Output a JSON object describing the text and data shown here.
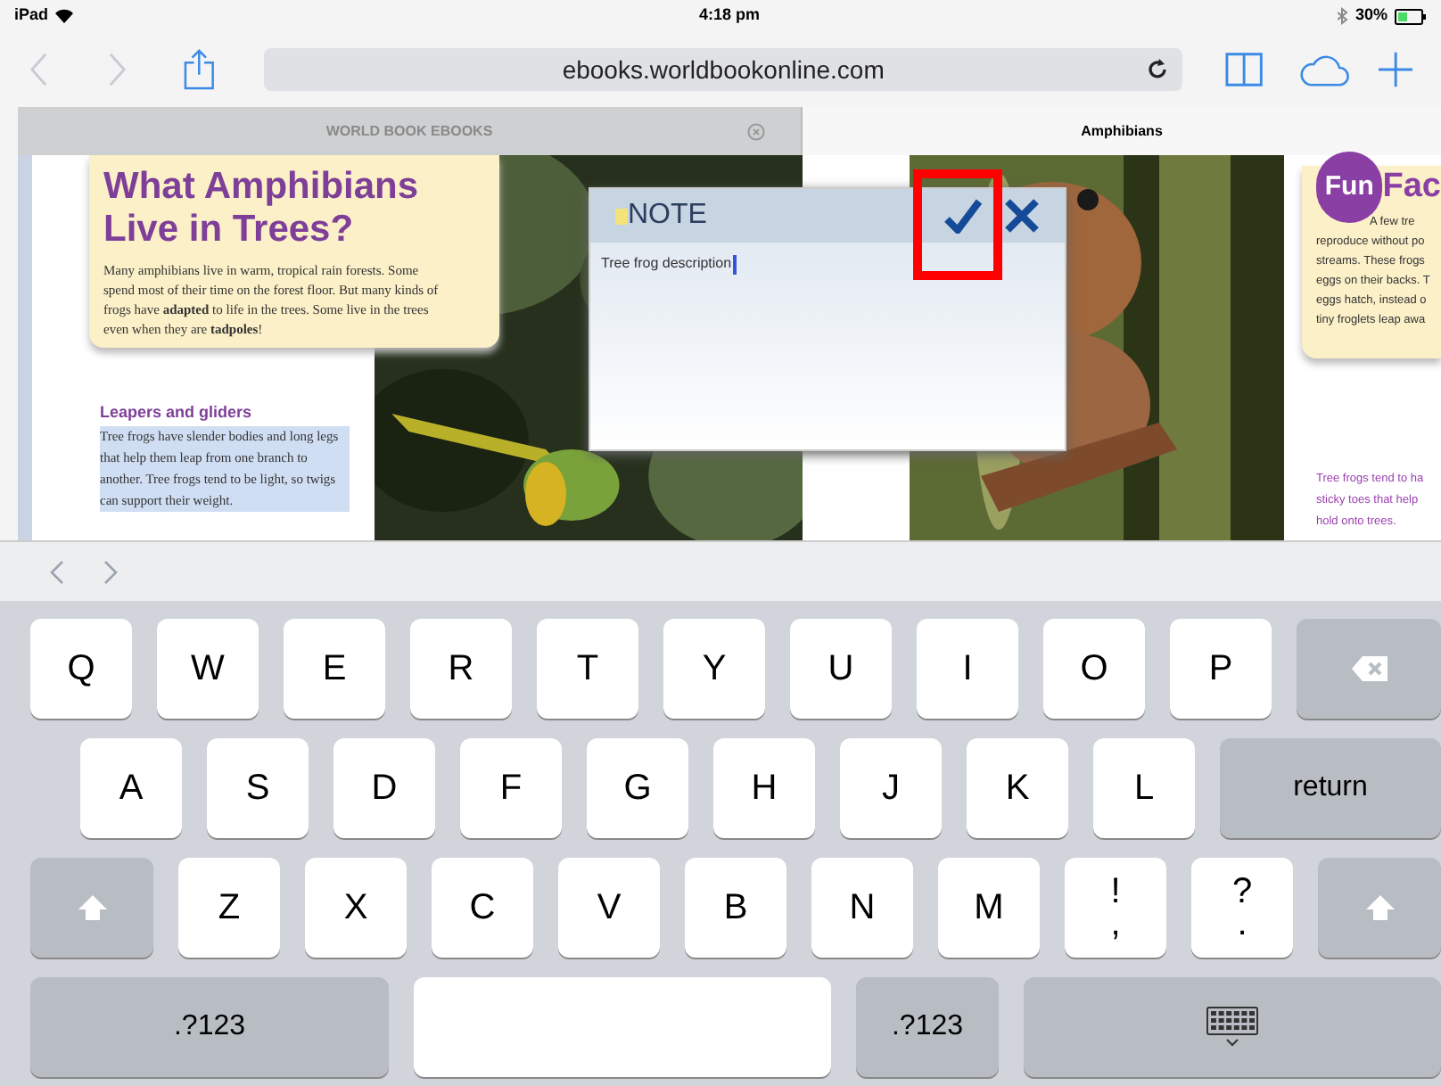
{
  "status_bar": {
    "device": "iPad",
    "time": "4:18 pm",
    "battery": "30%"
  },
  "toolbar": {
    "back_disabled": true,
    "forward_disabled": true,
    "address": "ebooks.worldbookonline.com"
  },
  "tabs": [
    {
      "label": "WORLD BOOK EBOOKS",
      "selected": false,
      "closable": true
    },
    {
      "label": "Amphibians",
      "selected": true,
      "closable": false
    }
  ],
  "page": {
    "title_lines": [
      "What Amphibians",
      "Live in Trees?"
    ],
    "intro": "Many amphibians live in warm, tropical rain forests. Some spend most of their time on the forest floor. But many kinds of frogs have **adapted** to life in the trees. Some live in the trees even when they are **tadpoles**!",
    "subheading": "Leapers and gliders",
    "selected_text": "Tree frogs have slender bodies and long legs that help them leap from one branch to another. Tree frogs tend to be light, so twigs can support their weight.",
    "fun_badge": "Fun",
    "fun_title": "Fac",
    "fun_lines": [
      "A few tre",
      "reproduce without po",
      "streams. These frogs",
      "eggs on their backs. T",
      "eggs hatch, instead o",
      "tiny froglets leap awa"
    ],
    "caption_lines": [
      "Tree frogs tend to ha",
      "sticky toes that help",
      "hold onto trees."
    ]
  },
  "note": {
    "title": "NOTE",
    "text": "Tree frog description"
  },
  "keyboard": {
    "rows": [
      {
        "keys": [
          {
            "kind": "key",
            "label": "Q"
          },
          {
            "kind": "key",
            "label": "W"
          },
          {
            "kind": "key",
            "label": "E"
          },
          {
            "kind": "key",
            "label": "R"
          },
          {
            "kind": "key",
            "label": "T"
          },
          {
            "kind": "key",
            "label": "Y"
          },
          {
            "kind": "key",
            "label": "U"
          },
          {
            "kind": "key",
            "label": "I"
          },
          {
            "kind": "key",
            "label": "O"
          },
          {
            "kind": "key",
            "label": "P"
          },
          {
            "kind": "backspace"
          }
        ]
      },
      {
        "keys": [
          {
            "kind": "key",
            "label": "A"
          },
          {
            "kind": "key",
            "label": "S"
          },
          {
            "kind": "key",
            "label": "D"
          },
          {
            "kind": "key",
            "label": "F"
          },
          {
            "kind": "key",
            "label": "G"
          },
          {
            "kind": "key",
            "label": "H"
          },
          {
            "kind": "key",
            "label": "J"
          },
          {
            "kind": "key",
            "label": "K"
          },
          {
            "kind": "key",
            "label": "L"
          },
          {
            "kind": "return",
            "label": "return"
          }
        ]
      },
      {
        "keys": [
          {
            "kind": "shift"
          },
          {
            "kind": "key",
            "label": "Z"
          },
          {
            "kind": "key",
            "label": "X"
          },
          {
            "kind": "key",
            "label": "C"
          },
          {
            "kind": "key",
            "label": "V"
          },
          {
            "kind": "key",
            "label": "B"
          },
          {
            "kind": "key",
            "label": "N"
          },
          {
            "kind": "key",
            "label": "M"
          },
          {
            "kind": "dual",
            "top": "!",
            "bottom": ","
          },
          {
            "kind": "dual",
            "top": "?",
            "bottom": "."
          },
          {
            "kind": "shift"
          }
        ]
      },
      {
        "keys": [
          {
            "kind": "mode",
            "label": ".?123"
          },
          {
            "kind": "space"
          },
          {
            "kind": "mode_small",
            "label": ".?123"
          },
          {
            "kind": "hide"
          }
        ]
      }
    ]
  }
}
